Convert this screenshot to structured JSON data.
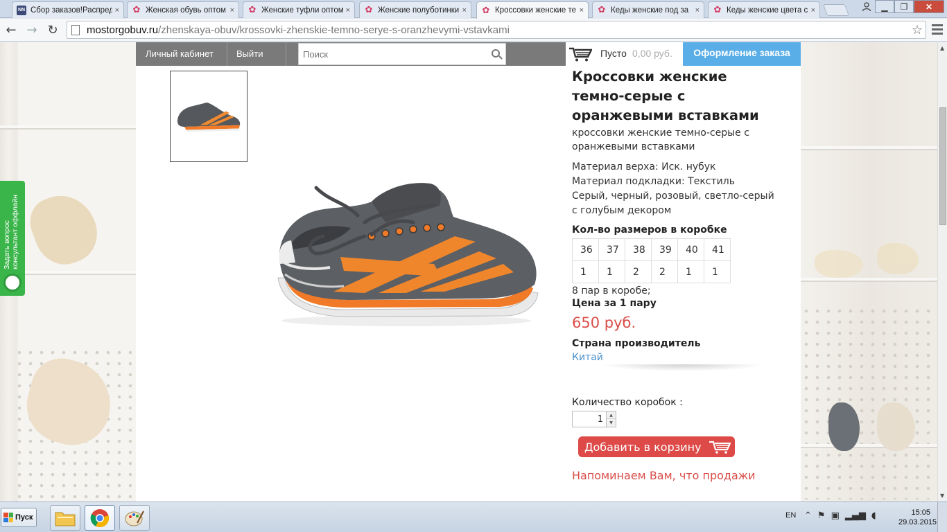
{
  "browser": {
    "tabs": [
      {
        "title": "Сбор заказов!Распред",
        "favicon": "nn-icon",
        "active": false
      },
      {
        "title": "Женская обувь оптом",
        "favicon": "flower-icon",
        "active": false
      },
      {
        "title": "Женские туфли оптом",
        "favicon": "flower-icon",
        "active": false
      },
      {
        "title": "Женские полуботинки",
        "favicon": "flower-icon",
        "active": false
      },
      {
        "title": "Кроссовки женские те",
        "favicon": "flower-icon",
        "active": true
      },
      {
        "title": "Кеды женские под за",
        "favicon": "flower-icon",
        "active": false
      },
      {
        "title": "Кеды женские цвета с",
        "favicon": "flower-icon",
        "active": false
      }
    ],
    "tab_close": "×",
    "url_domain": "mostorgobuv.ru",
    "url_path": "/zhenskaya-obuv/krossovki-zhenskie-temno-serye-s-oranzhevymi-vstavkami"
  },
  "nav": {
    "account": "Личный кабинет",
    "logout": "Выйти",
    "search_placeholder": "Поиск",
    "cart_status": "Пусто",
    "cart_sum": "0,00 руб.",
    "checkout": "Оформление заказа"
  },
  "widget": {
    "text_line1": "Задать вопрос",
    "text_line2": "консультант оффлайн"
  },
  "product": {
    "title": "Кроссовки женские темно-серые с оранжевыми вставками",
    "subtitle": "кроссовки женские темно-серые с оранжевыми вставками",
    "material_upper": "Материал верха: Иск. нубук",
    "material_lining": "Материал подкладки: Текстиль",
    "colors": "Серый, черный, розовый, светло-серый с голубым декором",
    "sizes_heading": "Кол-во размеров в коробке",
    "sizes": [
      "36",
      "37",
      "38",
      "39",
      "40",
      "41"
    ],
    "counts": [
      "1",
      "1",
      "2",
      "2",
      "1",
      "1"
    ],
    "pairs_note": "8 пар в коробе;",
    "price_heading": "Цена за 1 пару",
    "price": "650 руб.",
    "country_heading": "Страна производитель",
    "country": "Китай",
    "qty_label": "Количество коробок :",
    "qty_value": "1",
    "add_to_cart": "Добавить в корзину",
    "reminder": "Напоминаем Вам, что продажи"
  },
  "taskbar": {
    "start": "Пуск",
    "lang": "EN",
    "time": "15:05",
    "date": "29.03.2015"
  },
  "colors": {
    "accent_blue": "#5aaee8",
    "price_red": "#d94d48",
    "widget_green": "#3ab54a",
    "nav_gray": "#7a7a7a"
  }
}
